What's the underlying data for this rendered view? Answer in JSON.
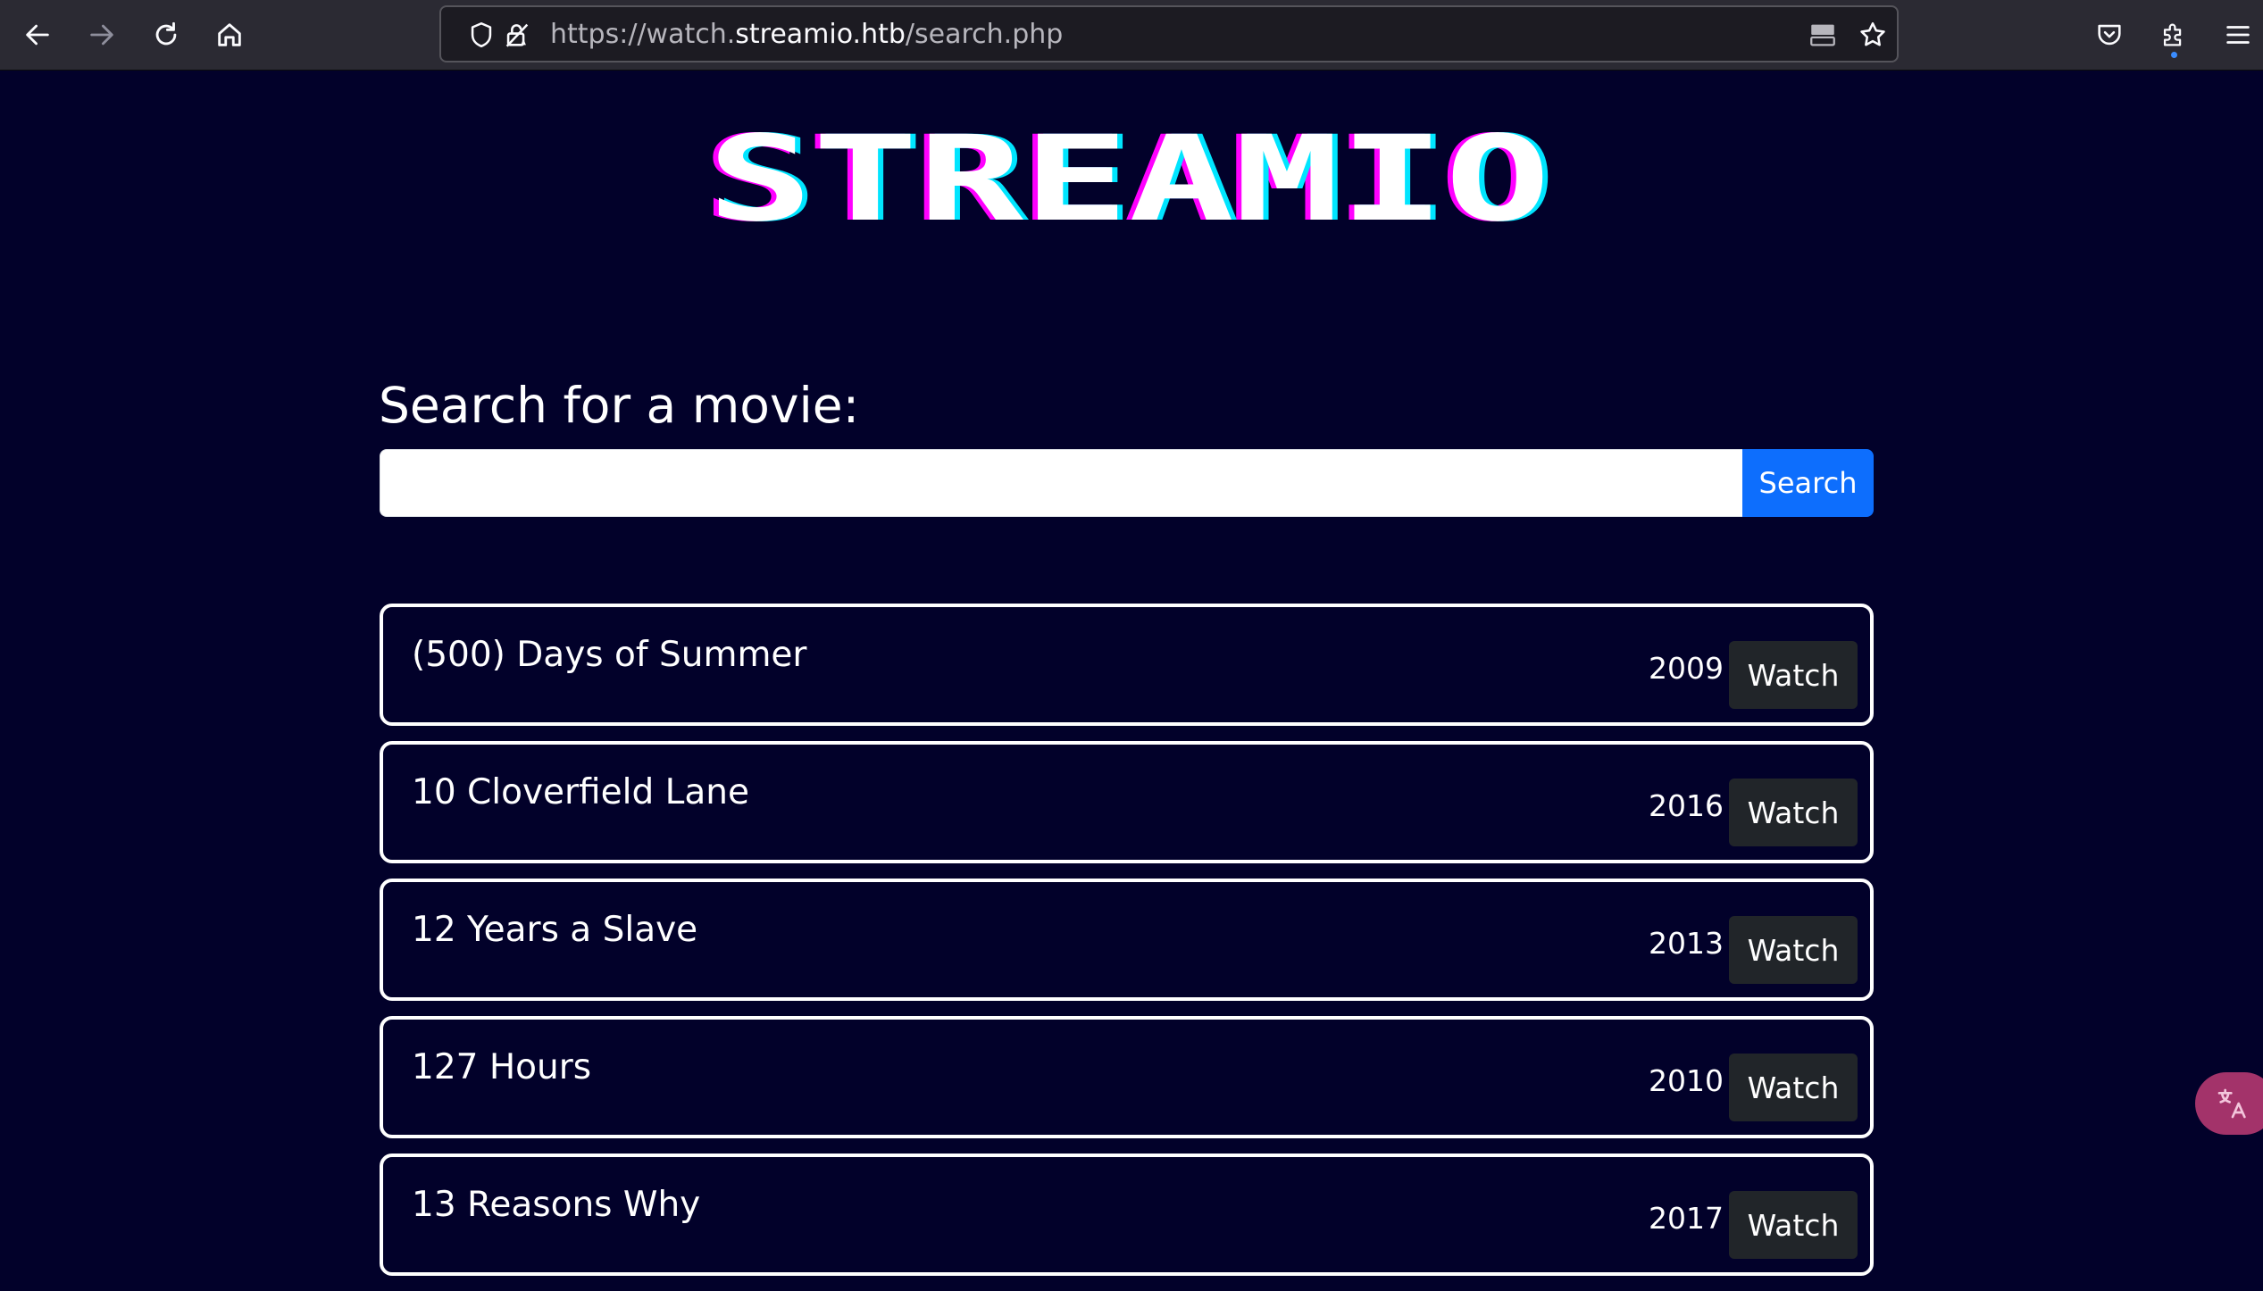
{
  "browser": {
    "url_prefix": "https://watch.",
    "url_domain": "streamio.htb",
    "url_path": "/search.php"
  },
  "logo": {
    "text": "STREAMIO"
  },
  "search": {
    "heading": "Search for a movie:",
    "value": "",
    "button_label": "Search"
  },
  "movies": [
    {
      "title": "(500) Days of Summer",
      "year": "2009",
      "action": "Watch"
    },
    {
      "title": "10 Cloverfield Lane",
      "year": "2016",
      "action": "Watch"
    },
    {
      "title": "12 Years a Slave",
      "year": "2013",
      "action": "Watch"
    },
    {
      "title": "127 Hours",
      "year": "2010",
      "action": "Watch"
    },
    {
      "title": "13 Reasons Why",
      "year": "2017",
      "action": "Watch"
    }
  ],
  "colors": {
    "page_background": "#02012a",
    "primary_button": "#0d6efd",
    "watch_button": "#212529",
    "logo_pink": "#ff00ff",
    "logo_cyan": "#00e5ff"
  }
}
